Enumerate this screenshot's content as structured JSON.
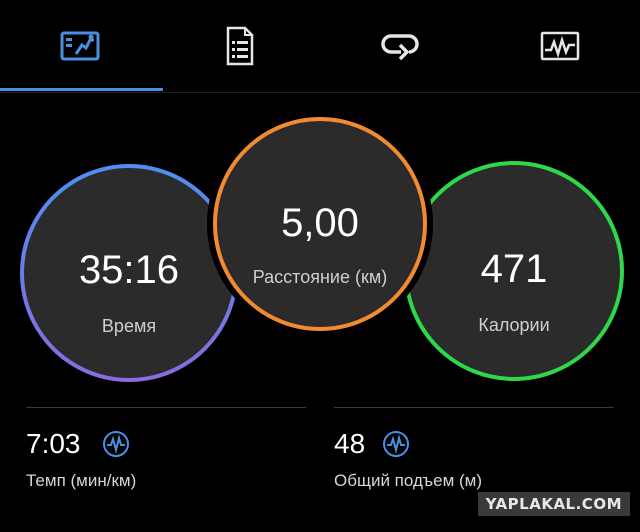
{
  "tabs": [
    {
      "id": "overview",
      "icon": "run-stats-icon",
      "active": true
    },
    {
      "id": "details",
      "icon": "list-document-icon",
      "active": false
    },
    {
      "id": "laps",
      "icon": "lap-loop-icon",
      "active": false
    },
    {
      "id": "charts",
      "icon": "activity-chart-icon",
      "active": false
    }
  ],
  "rings": {
    "time": {
      "value": "35:16",
      "label": "Время",
      "color": "#6f7fe8"
    },
    "distance": {
      "value": "5,00",
      "label": "Расстояние (км)",
      "color": "#f28a33"
    },
    "calories": {
      "value": "471",
      "label": "Калории",
      "color": "#2ed84a"
    }
  },
  "stats": {
    "pace": {
      "value": "7:03",
      "label": "Темп (мин/км)",
      "icon": "heart-rate-wave-icon"
    },
    "ascent": {
      "value": "48",
      "label": "Общий подъем (м)",
      "icon": "heart-rate-wave-icon"
    }
  },
  "watermark": "YAPLAKAL.COM",
  "colors": {
    "accent": "#4a90e2",
    "ring_bg": "#2b2b2b"
  }
}
